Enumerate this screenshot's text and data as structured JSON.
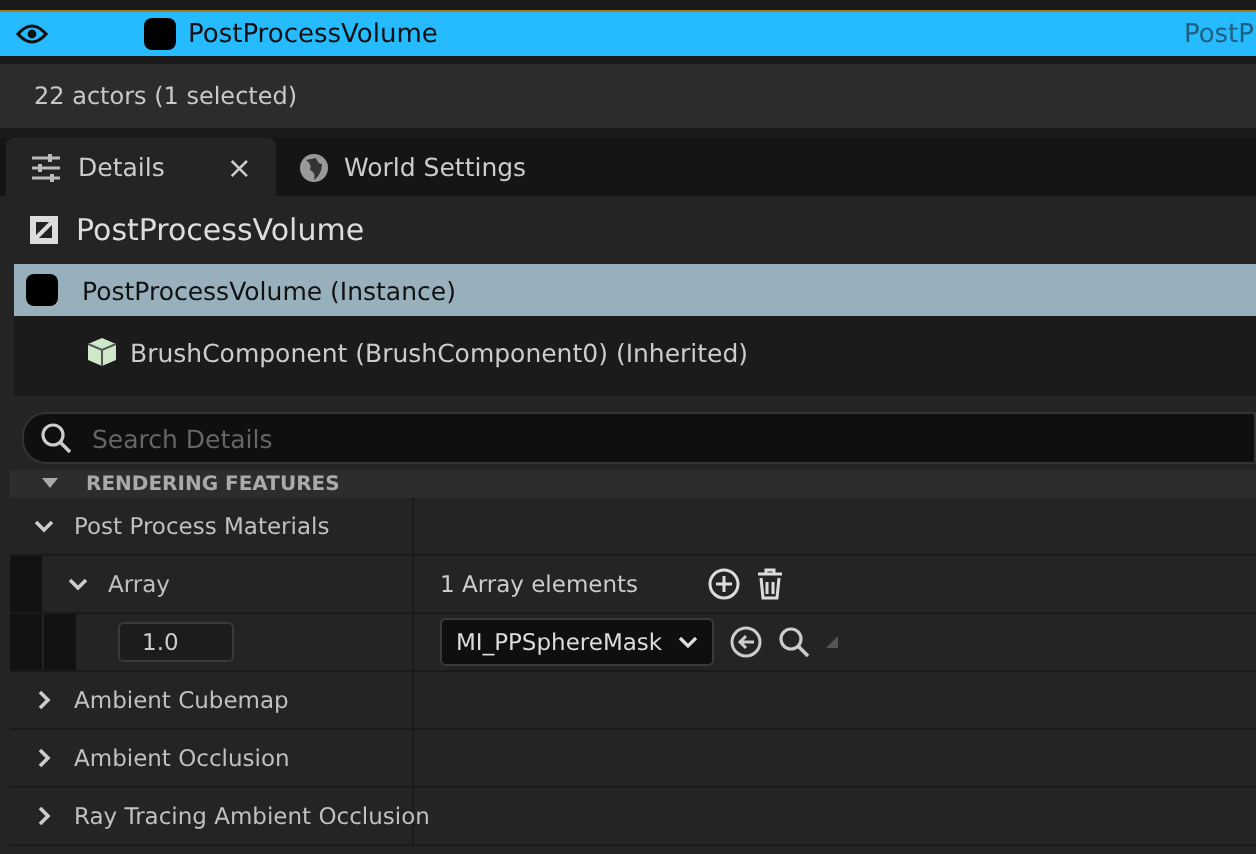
{
  "outliner": {
    "rows": [
      {
        "label": "PostProcessVolume",
        "type_text": "PostP",
        "visible": true,
        "selected": true
      }
    ]
  },
  "status_bar": {
    "text": "22 actors (1 selected)"
  },
  "tabs": [
    {
      "label": "Details",
      "kind": "details",
      "selected": true,
      "close_label": "×"
    },
    {
      "label": "World Settings",
      "kind": "world",
      "selected": false
    }
  ],
  "details": {
    "actor_title": "PostProcessVolume",
    "components": [
      {
        "label": "PostProcessVolume (Instance)",
        "kind": "actor",
        "selected": true
      },
      {
        "label": "BrushComponent (BrushComponent0) (Inherited)",
        "kind": "brush",
        "selected": false
      }
    ],
    "search": {
      "placeholder": "Search Details"
    },
    "category": {
      "label": "RENDERING FEATURES",
      "expanded": true
    },
    "properties": [
      {
        "kind": "group",
        "label": "Post Process Materials",
        "expanded": true,
        "children": [
          {
            "kind": "array",
            "label": "Array",
            "expanded": true,
            "value": "1 Array elements",
            "children": [
              {
                "kind": "element",
                "weight": "1.0",
                "asset": "MI_PPSphereMask"
              }
            ]
          }
        ]
      },
      {
        "kind": "group",
        "label": "Ambient Cubemap",
        "expanded": false
      },
      {
        "kind": "group",
        "label": "Ambient Occlusion",
        "expanded": false
      },
      {
        "kind": "group",
        "label": "Ray Tracing Ambient Occlusion",
        "expanded": false
      }
    ]
  }
}
